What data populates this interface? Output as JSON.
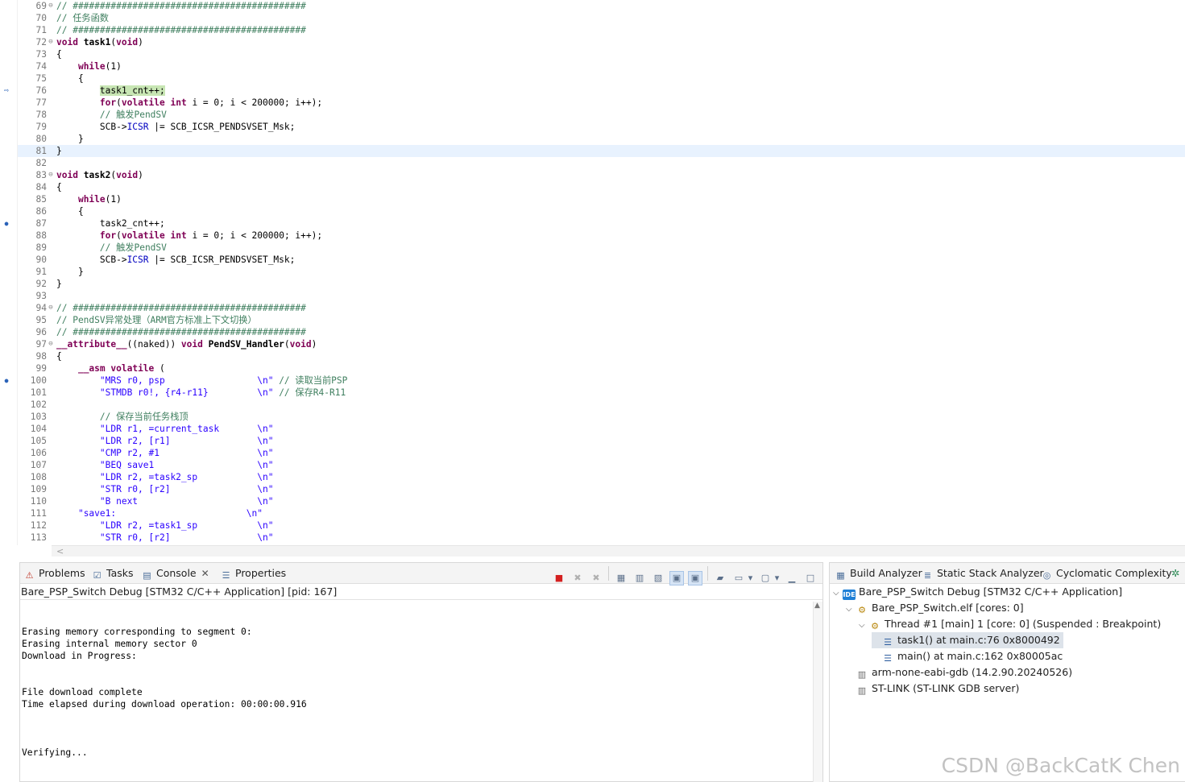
{
  "editor": {
    "lines": [
      {
        "n": "69",
        "fold": "⊖",
        "segs": [
          [
            "// ###########################################",
            "c-com"
          ]
        ]
      },
      {
        "n": "70",
        "segs": [
          [
            "// 任务函数",
            "c-com"
          ]
        ]
      },
      {
        "n": "71",
        "segs": [
          [
            "// ###########################################",
            "c-com"
          ]
        ]
      },
      {
        "n": "72",
        "fold": "⊖",
        "segs": [
          [
            "void",
            "c-kw"
          ],
          [
            " ",
            ""
          ],
          [
            "task1",
            "c-fn"
          ],
          [
            "(",
            ""
          ],
          [
            "void",
            "c-kw"
          ],
          [
            ")",
            ""
          ]
        ]
      },
      {
        "n": "73",
        "segs": [
          [
            "{",
            ""
          ]
        ]
      },
      {
        "n": "74",
        "segs": [
          [
            "    ",
            ""
          ],
          [
            "while",
            "c-kw"
          ],
          [
            "(1)",
            ""
          ]
        ]
      },
      {
        "n": "75",
        "segs": [
          [
            "    {",
            ""
          ]
        ]
      },
      {
        "n": "76",
        "bp": "debug",
        "segs": [
          [
            "        ",
            ""
          ],
          [
            "task1_cnt++;",
            "hl"
          ]
        ],
        "hlfull": true
      },
      {
        "n": "77",
        "segs": [
          [
            "        ",
            ""
          ],
          [
            "for",
            "c-kw"
          ],
          [
            "(",
            ""
          ],
          [
            "volatile",
            "c-kw"
          ],
          [
            " ",
            ""
          ],
          [
            "int",
            "c-kw"
          ],
          [
            " i = 0; i < 200000; i++);",
            ""
          ]
        ]
      },
      {
        "n": "78",
        "segs": [
          [
            "        ",
            ""
          ],
          [
            "// 触发PendSV",
            "c-com"
          ]
        ]
      },
      {
        "n": "79",
        "segs": [
          [
            "        SCB->",
            ""
          ],
          [
            "ICSR",
            "c-mac"
          ],
          [
            " |= SCB_ICSR_PENDSVSET_Msk;",
            ""
          ]
        ]
      },
      {
        "n": "80",
        "segs": [
          [
            "    }",
            ""
          ]
        ]
      },
      {
        "n": "81",
        "cur": true,
        "segs": [
          [
            "}",
            ""
          ]
        ]
      },
      {
        "n": "82",
        "segs": []
      },
      {
        "n": "83",
        "fold": "⊖",
        "segs": [
          [
            "void",
            "c-kw"
          ],
          [
            " ",
            ""
          ],
          [
            "task2",
            "c-fn"
          ],
          [
            "(",
            ""
          ],
          [
            "void",
            "c-kw"
          ],
          [
            ")",
            ""
          ]
        ]
      },
      {
        "n": "84",
        "segs": [
          [
            "{",
            ""
          ]
        ]
      },
      {
        "n": "85",
        "segs": [
          [
            "    ",
            ""
          ],
          [
            "while",
            "c-kw"
          ],
          [
            "(1)",
            ""
          ]
        ]
      },
      {
        "n": "86",
        "segs": [
          [
            "    {",
            ""
          ]
        ]
      },
      {
        "n": "87",
        "bp": "bp",
        "segs": [
          [
            "        task2_cnt++;",
            ""
          ]
        ]
      },
      {
        "n": "88",
        "segs": [
          [
            "        ",
            ""
          ],
          [
            "for",
            "c-kw"
          ],
          [
            "(",
            ""
          ],
          [
            "volatile",
            "c-kw"
          ],
          [
            " ",
            ""
          ],
          [
            "int",
            "c-kw"
          ],
          [
            " i = 0; i < 200000; i++);",
            ""
          ]
        ]
      },
      {
        "n": "89",
        "segs": [
          [
            "        ",
            ""
          ],
          [
            "// 触发PendSV",
            "c-com"
          ]
        ]
      },
      {
        "n": "90",
        "segs": [
          [
            "        SCB->",
            ""
          ],
          [
            "ICSR",
            "c-mac"
          ],
          [
            " |= SCB_ICSR_PENDSVSET_Msk;",
            ""
          ]
        ]
      },
      {
        "n": "91",
        "segs": [
          [
            "    }",
            ""
          ]
        ]
      },
      {
        "n": "92",
        "segs": [
          [
            "}",
            ""
          ]
        ]
      },
      {
        "n": "93",
        "segs": []
      },
      {
        "n": "94",
        "fold": "⊖",
        "segs": [
          [
            "// ###########################################",
            "c-com"
          ]
        ]
      },
      {
        "n": "95",
        "segs": [
          [
            "// PendSV异常处理（ARM官方标准上下文切换）",
            "c-com"
          ]
        ]
      },
      {
        "n": "96",
        "segs": [
          [
            "// ###########################################",
            "c-com"
          ]
        ]
      },
      {
        "n": "97",
        "fold": "⊖",
        "segs": [
          [
            "__attribute__",
            "c-kw"
          ],
          [
            "((naked)) ",
            ""
          ],
          [
            "void",
            "c-kw"
          ],
          [
            " ",
            ""
          ],
          [
            "PendSV_Handler",
            "c-fn"
          ],
          [
            "(",
            ""
          ],
          [
            "void",
            "c-kw"
          ],
          [
            ")",
            ""
          ]
        ]
      },
      {
        "n": "98",
        "segs": [
          [
            "{",
            ""
          ]
        ]
      },
      {
        "n": "99",
        "segs": [
          [
            "    ",
            ""
          ],
          [
            "__asm",
            "c-kw"
          ],
          [
            " ",
            ""
          ],
          [
            "volatile",
            "c-kw"
          ],
          [
            " (",
            ""
          ]
        ]
      },
      {
        "n": "100",
        "bp": "bp",
        "segs": [
          [
            "        ",
            ""
          ],
          [
            "\"MRS r0, psp                 \\n\"",
            "c-str"
          ],
          [
            " ",
            ""
          ],
          [
            "// 读取当前PSP",
            "c-com"
          ]
        ]
      },
      {
        "n": "101",
        "segs": [
          [
            "        ",
            ""
          ],
          [
            "\"STMDB r0!, {r4-r11}         \\n\"",
            "c-str"
          ],
          [
            " ",
            ""
          ],
          [
            "// 保存R4-R11",
            "c-com"
          ]
        ]
      },
      {
        "n": "102",
        "segs": []
      },
      {
        "n": "103",
        "segs": [
          [
            "        ",
            ""
          ],
          [
            "// 保存当前任务栈顶",
            "c-com"
          ]
        ]
      },
      {
        "n": "104",
        "segs": [
          [
            "        ",
            ""
          ],
          [
            "\"LDR r1, =current_task       \\n\"",
            "c-str"
          ]
        ]
      },
      {
        "n": "105",
        "segs": [
          [
            "        ",
            ""
          ],
          [
            "\"LDR r2, [r1]                \\n\"",
            "c-str"
          ]
        ]
      },
      {
        "n": "106",
        "segs": [
          [
            "        ",
            ""
          ],
          [
            "\"CMP r2, #1                  \\n\"",
            "c-str"
          ]
        ]
      },
      {
        "n": "107",
        "segs": [
          [
            "        ",
            ""
          ],
          [
            "\"BEQ save1                   \\n\"",
            "c-str"
          ]
        ]
      },
      {
        "n": "108",
        "segs": [
          [
            "        ",
            ""
          ],
          [
            "\"LDR r2, =task2_sp           \\n\"",
            "c-str"
          ]
        ]
      },
      {
        "n": "109",
        "segs": [
          [
            "        ",
            ""
          ],
          [
            "\"STR r0, [r2]                \\n\"",
            "c-str"
          ]
        ]
      },
      {
        "n": "110",
        "segs": [
          [
            "        ",
            ""
          ],
          [
            "\"B next                      \\n\"",
            "c-str"
          ]
        ]
      },
      {
        "n": "111",
        "segs": [
          [
            "    ",
            ""
          ],
          [
            "\"save1:                        \\n\"",
            "c-str"
          ]
        ]
      },
      {
        "n": "112",
        "segs": [
          [
            "        ",
            ""
          ],
          [
            "\"LDR r2, =task1_sp           \\n\"",
            "c-str"
          ]
        ]
      },
      {
        "n": "113",
        "segs": [
          [
            "        ",
            ""
          ],
          [
            "\"STR r0, [r2]                \\n\"",
            "c-str"
          ]
        ]
      }
    ]
  },
  "console_view": {
    "tabs": [
      {
        "label": "Problems",
        "icon": "problems-icon",
        "glyph": "⚠"
      },
      {
        "label": "Tasks",
        "icon": "tasks-icon",
        "glyph": "☑"
      },
      {
        "label": "Console",
        "icon": "console-icon",
        "glyph": "▤",
        "active": true
      },
      {
        "label": "Properties",
        "icon": "properties-icon",
        "glyph": "☰"
      }
    ],
    "title": "Bare_PSP_Switch Debug [STM32 C/C++ Application]  [pid: 167]",
    "output": [
      "",
      "",
      "Erasing memory corresponding to segment 0:",
      "Erasing internal memory sector 0",
      "Download in Progress:",
      "",
      "",
      "File download complete",
      "Time elapsed during download operation: 00:00:00.916",
      "",
      "",
      "",
      "Verifying..."
    ],
    "toolbar": [
      {
        "name": "terminate-icon",
        "glyph": "■",
        "cls": "red"
      },
      {
        "name": "remove-launch-icon",
        "glyph": "✖",
        "cls": "grey"
      },
      {
        "name": "remove-all-launches-icon",
        "glyph": "✖",
        "cls": "grey"
      },
      {
        "name": "sep",
        "cls": "sep"
      },
      {
        "name": "clear-console-icon",
        "glyph": "▦",
        "cls": ""
      },
      {
        "name": "scroll-lock-icon",
        "glyph": "▥",
        "cls": ""
      },
      {
        "name": "word-wrap-icon",
        "glyph": "▧",
        "cls": ""
      },
      {
        "name": "show-on-stdout-icon",
        "glyph": "▣",
        "cls": "active"
      },
      {
        "name": "show-on-stderr-icon",
        "glyph": "▣",
        "cls": "active"
      },
      {
        "name": "sep",
        "cls": "sep"
      },
      {
        "name": "pin-console-icon",
        "glyph": "▰",
        "cls": ""
      },
      {
        "name": "display-console-icon",
        "glyph": "▭",
        "cls": ""
      },
      {
        "name": "display-console-dropdown-icon",
        "glyph": "▾",
        "cls": ""
      },
      {
        "name": "open-console-icon",
        "glyph": "▢",
        "cls": ""
      },
      {
        "name": "open-console-dropdown-icon",
        "glyph": "▾",
        "cls": ""
      },
      {
        "name": "minimize-icon",
        "glyph": "▁",
        "cls": ""
      },
      {
        "name": "maximize-icon",
        "glyph": "□",
        "cls": ""
      }
    ]
  },
  "debug_view": {
    "tabs": [
      {
        "label": "Build Analyzer",
        "icon": "build-analyzer-icon",
        "glyph": "▦"
      },
      {
        "label": "Static Stack Analyzer",
        "icon": "static-stack-analyzer-icon",
        "glyph": "≣"
      },
      {
        "label": "Cyclomatic Complexity",
        "icon": "cyclomatic-complexity-icon",
        "glyph": "◎"
      }
    ],
    "tree": [
      {
        "depth": 0,
        "chev": "⌵",
        "icon": "ide-launch-icon",
        "badge": "IDE",
        "label": "Bare_PSP_Switch Debug [STM32 C/C++ Application]"
      },
      {
        "depth": 1,
        "chev": "⌵",
        "icon": "elf-process-icon",
        "glyph": "⚙",
        "label": "Bare_PSP_Switch.elf [cores: 0]"
      },
      {
        "depth": 2,
        "chev": "⌵",
        "icon": "thread-icon",
        "glyph": "⚙",
        "label": "Thread #1 [main] 1 [core: 0] (Suspended : Breakpoint)"
      },
      {
        "depth": 3,
        "chev": "",
        "icon": "stack-frame-icon",
        "glyph": "☰",
        "label": "task1() at main.c:76 0x8000492",
        "selected": true
      },
      {
        "depth": 3,
        "chev": "",
        "icon": "stack-frame-icon",
        "glyph": "☰",
        "label": "main() at main.c:162 0x80005ac"
      },
      {
        "depth": 1,
        "chev": "",
        "icon": "gdb-process-icon",
        "glyph": "▥",
        "label": "arm-none-eabi-gdb (14.2.90.20240526)"
      },
      {
        "depth": 1,
        "chev": "",
        "icon": "gdb-server-icon",
        "glyph": "▥",
        "label": "ST-LINK (ST-LINK GDB server)"
      }
    ]
  },
  "watermark": "CSDN @BackCatK Chen",
  "colors": {
    "keyword": "#7f0055",
    "comment": "#3f7f5f",
    "string": "#2a00ff",
    "highlight": "#c8e6b4",
    "current_line": "#e8f2fe"
  }
}
